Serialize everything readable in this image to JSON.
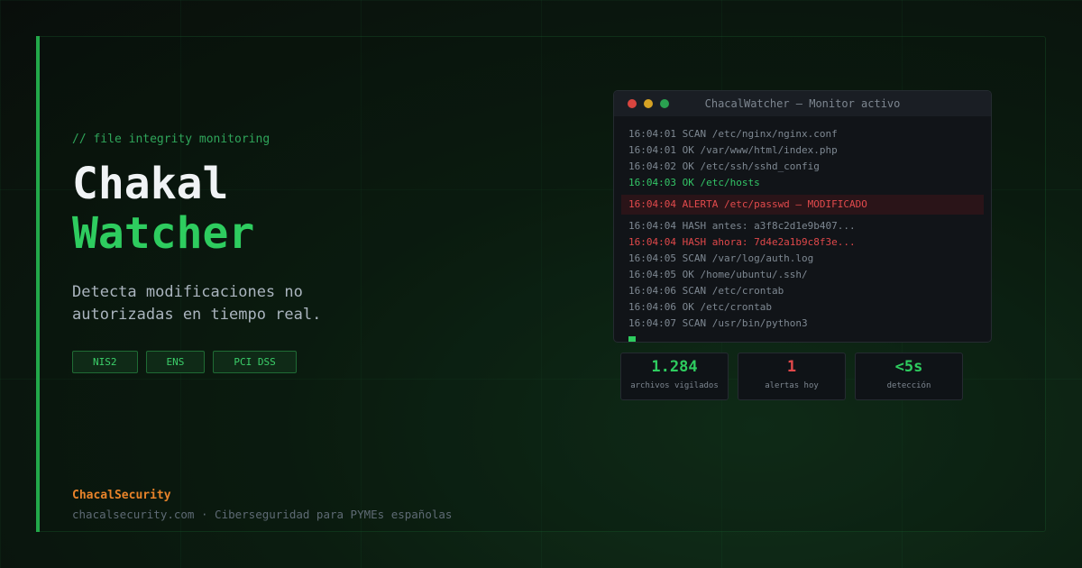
{
  "hero": {
    "comment": "// file integrity monitoring",
    "title_line1": "Chakal",
    "title_line2": "Watcher",
    "tagline": "Detecta modificaciones no autorizadas en tiempo real.",
    "badges": [
      "NIS2",
      "ENS",
      "PCI DSS"
    ]
  },
  "footer": {
    "brand": "ChacalSecurity",
    "line": "chacalsecurity.com · Ciberseguridad para PYMEs españolas"
  },
  "terminal": {
    "title": "ChacalWatcher — Monitor activo",
    "lines": [
      {
        "text": "16:04:01 SCAN /etc/nginx/nginx.conf",
        "kind": "normal"
      },
      {
        "text": "16:04:01 OK /var/www/html/index.php",
        "kind": "normal"
      },
      {
        "text": "16:04:02 OK /etc/ssh/sshd_config",
        "kind": "normal"
      },
      {
        "text": "16:04:03 OK /etc/hosts",
        "kind": "ok"
      },
      {
        "text": "16:04:04 ALERTA /etc/passwd — MODIFICADO",
        "kind": "alert"
      },
      {
        "text": "16:04:04 HASH antes: a3f8c2d1e9b407...",
        "kind": "normal"
      },
      {
        "text": "16:04:04 HASH ahora: 7d4e2a1b9c8f3e...",
        "kind": "red"
      },
      {
        "text": "16:04:05 SCAN /var/log/auth.log",
        "kind": "normal"
      },
      {
        "text": "16:04:05 OK /home/ubuntu/.ssh/",
        "kind": "normal"
      },
      {
        "text": "16:04:06 SCAN /etc/crontab",
        "kind": "normal"
      },
      {
        "text": "16:04:06 OK /etc/crontab",
        "kind": "normal"
      },
      {
        "text": "16:04:07 SCAN /usr/bin/python3",
        "kind": "normal"
      }
    ]
  },
  "stats": [
    {
      "value": "1.284",
      "label": "archivos vigilados",
      "color": "green"
    },
    {
      "value": "1",
      "label": "alertas hoy",
      "color": "red"
    },
    {
      "value": "<5s",
      "label": "detección",
      "color": "green"
    }
  ],
  "colors": {
    "accent": "#2ecc5f",
    "alert": "#e2484a",
    "brand": "#e8832a"
  }
}
